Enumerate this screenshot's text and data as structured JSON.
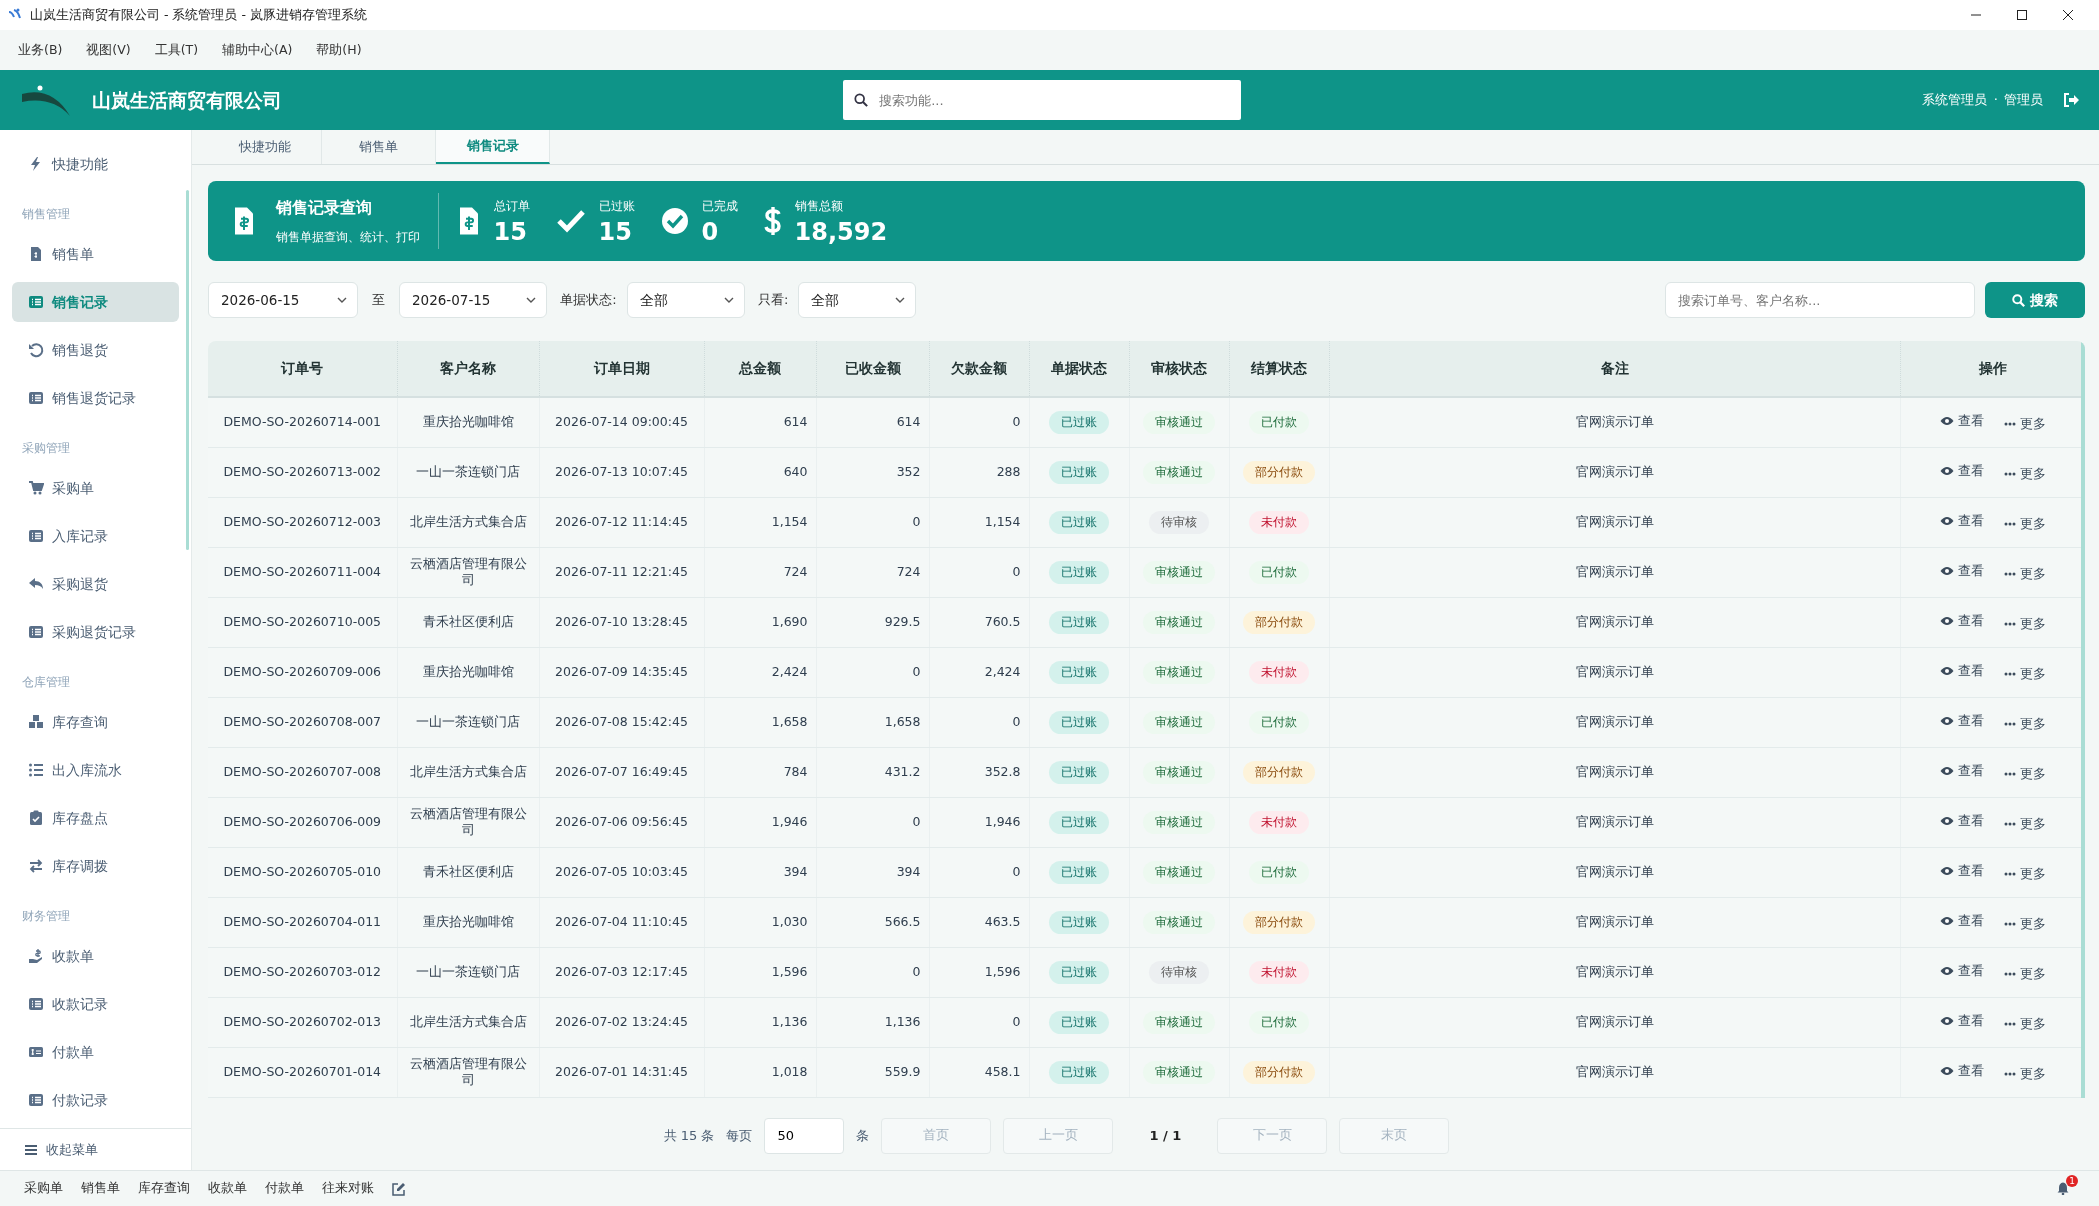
{
  "window": {
    "title": "山岚生活商贸有限公司 - 系统管理员 - 岚豚进销存管理系统"
  },
  "menu": [
    "业务(B)",
    "视图(V)",
    "工具(T)",
    "辅助中心(A)",
    "帮助(H)"
  ],
  "header": {
    "company": "山岚生活商贸有限公司",
    "search": {
      "placeholder": "搜索功能..."
    },
    "user": "系统管理员",
    "separator": "·",
    "role": "管理员"
  },
  "sidebar": {
    "items": [
      {
        "kind": "item",
        "label": "快捷功能",
        "selected": false
      },
      {
        "kind": "group",
        "label": "销售管理"
      },
      {
        "kind": "item",
        "label": "销售单",
        "selected": false
      },
      {
        "kind": "item",
        "label": "销售记录",
        "selected": true
      },
      {
        "kind": "item",
        "label": "销售退货",
        "selected": false
      },
      {
        "kind": "item",
        "label": "销售退货记录",
        "selected": false
      },
      {
        "kind": "group",
        "label": "采购管理"
      },
      {
        "kind": "item",
        "label": "采购单",
        "selected": false
      },
      {
        "kind": "item",
        "label": "入库记录",
        "selected": false
      },
      {
        "kind": "item",
        "label": "采购退货",
        "selected": false
      },
      {
        "kind": "item",
        "label": "采购退货记录",
        "selected": false
      },
      {
        "kind": "group",
        "label": "仓库管理"
      },
      {
        "kind": "item",
        "label": "库存查询",
        "selected": false
      },
      {
        "kind": "item",
        "label": "出入库流水",
        "selected": false
      },
      {
        "kind": "item",
        "label": "库存盘点",
        "selected": false
      },
      {
        "kind": "item",
        "label": "库存调拨",
        "selected": false
      },
      {
        "kind": "group",
        "label": "财务管理"
      },
      {
        "kind": "item",
        "label": "收款单",
        "selected": false
      },
      {
        "kind": "item",
        "label": "收款记录",
        "selected": false
      },
      {
        "kind": "item",
        "label": "付款单",
        "selected": false
      },
      {
        "kind": "item",
        "label": "付款记录",
        "selected": false
      }
    ],
    "collapse": "收起菜单"
  },
  "tabs": [
    {
      "label": "快捷功能",
      "selected": false
    },
    {
      "label": "销售单",
      "selected": false
    },
    {
      "label": "销售记录",
      "selected": true
    }
  ],
  "summary": {
    "title": "销售记录查询",
    "subtitle": "销售单据查询、统计、打印",
    "stats": [
      {
        "label": "总订单",
        "value": "15"
      },
      {
        "label": "已过账",
        "value": "15"
      },
      {
        "label": "已完成",
        "value": "0"
      },
      {
        "label": "销售总额",
        "value": "18,592"
      }
    ]
  },
  "filters": {
    "date_from": "2026-06-15",
    "to": "至",
    "date_to": "2026-07-15",
    "status_label": "单据状态:",
    "status": "全部",
    "only_label": "只看:",
    "only": "全部",
    "search": {
      "placeholder": "搜索订单号、客户名称..."
    },
    "search_button": "搜索"
  },
  "table": {
    "columns": [
      "订单号",
      "客户名称",
      "订单日期",
      "总金额",
      "已收金额",
      "欠款金额",
      "单据状态",
      "审核状态",
      "结算状态",
      "备注",
      "操作"
    ],
    "rows": [
      {
        "order": "DEMO-SO-20260714-001",
        "customer": "重庆拾光咖啡馆",
        "date": "2026-07-14 09:00:45",
        "total": "614",
        "received": "614",
        "owed": "0",
        "doc": {
          "text": "已过账",
          "kind": "posted"
        },
        "audit": {
          "text": "审核通过",
          "kind": "approved"
        },
        "settle": {
          "text": "已付款",
          "kind": "paid"
        },
        "note": "官网演示订单",
        "view": "查看",
        "more": "更多"
      },
      {
        "order": "DEMO-SO-20260713-002",
        "customer": "一山一茶连锁门店",
        "date": "2026-07-13 10:07:45",
        "total": "640",
        "received": "352",
        "owed": "288",
        "doc": {
          "text": "已过账",
          "kind": "posted"
        },
        "audit": {
          "text": "审核通过",
          "kind": "approved"
        },
        "settle": {
          "text": "部分付款",
          "kind": "partial"
        },
        "note": "官网演示订单",
        "view": "查看",
        "more": "更多"
      },
      {
        "order": "DEMO-SO-20260712-003",
        "customer": "北岸生活方式集合店",
        "date": "2026-07-12 11:14:45",
        "total": "1,154",
        "received": "0",
        "owed": "1,154",
        "doc": {
          "text": "已过账",
          "kind": "posted"
        },
        "audit": {
          "text": "待审核",
          "kind": "pending"
        },
        "settle": {
          "text": "未付款",
          "kind": "unpaid"
        },
        "note": "官网演示订单",
        "view": "查看",
        "more": "更多"
      },
      {
        "order": "DEMO-SO-20260711-004",
        "customer": "云栖酒店管理有限公司",
        "date": "2026-07-11 12:21:45",
        "total": "724",
        "received": "724",
        "owed": "0",
        "doc": {
          "text": "已过账",
          "kind": "posted"
        },
        "audit": {
          "text": "审核通过",
          "kind": "approved"
        },
        "settle": {
          "text": "已付款",
          "kind": "paid"
        },
        "note": "官网演示订单",
        "view": "查看",
        "more": "更多"
      },
      {
        "order": "DEMO-SO-20260710-005",
        "customer": "青禾社区便利店",
        "date": "2026-07-10 13:28:45",
        "total": "1,690",
        "received": "929.5",
        "owed": "760.5",
        "doc": {
          "text": "已过账",
          "kind": "posted"
        },
        "audit": {
          "text": "审核通过",
          "kind": "approved"
        },
        "settle": {
          "text": "部分付款",
          "kind": "partial"
        },
        "note": "官网演示订单",
        "view": "查看",
        "more": "更多"
      },
      {
        "order": "DEMO-SO-20260709-006",
        "customer": "重庆拾光咖啡馆",
        "date": "2026-07-09 14:35:45",
        "total": "2,424",
        "received": "0",
        "owed": "2,424",
        "doc": {
          "text": "已过账",
          "kind": "posted"
        },
        "audit": {
          "text": "审核通过",
          "kind": "approved"
        },
        "settle": {
          "text": "未付款",
          "kind": "unpaid"
        },
        "note": "官网演示订单",
        "view": "查看",
        "more": "更多"
      },
      {
        "order": "DEMO-SO-20260708-007",
        "customer": "一山一茶连锁门店",
        "date": "2026-07-08 15:42:45",
        "total": "1,658",
        "received": "1,658",
        "owed": "0",
        "doc": {
          "text": "已过账",
          "kind": "posted"
        },
        "audit": {
          "text": "审核通过",
          "kind": "approved"
        },
        "settle": {
          "text": "已付款",
          "kind": "paid"
        },
        "note": "官网演示订单",
        "view": "查看",
        "more": "更多"
      },
      {
        "order": "DEMO-SO-20260707-008",
        "customer": "北岸生活方式集合店",
        "date": "2026-07-07 16:49:45",
        "total": "784",
        "received": "431.2",
        "owed": "352.8",
        "doc": {
          "text": "已过账",
          "kind": "posted"
        },
        "audit": {
          "text": "审核通过",
          "kind": "approved"
        },
        "settle": {
          "text": "部分付款",
          "kind": "partial"
        },
        "note": "官网演示订单",
        "view": "查看",
        "more": "更多"
      },
      {
        "order": "DEMO-SO-20260706-009",
        "customer": "云栖酒店管理有限公司",
        "date": "2026-07-06 09:56:45",
        "total": "1,946",
        "received": "0",
        "owed": "1,946",
        "doc": {
          "text": "已过账",
          "kind": "posted"
        },
        "audit": {
          "text": "审核通过",
          "kind": "approved"
        },
        "settle": {
          "text": "未付款",
          "kind": "unpaid"
        },
        "note": "官网演示订单",
        "view": "查看",
        "more": "更多"
      },
      {
        "order": "DEMO-SO-20260705-010",
        "customer": "青禾社区便利店",
        "date": "2026-07-05 10:03:45",
        "total": "394",
        "received": "394",
        "owed": "0",
        "doc": {
          "text": "已过账",
          "kind": "posted"
        },
        "audit": {
          "text": "审核通过",
          "kind": "approved"
        },
        "settle": {
          "text": "已付款",
          "kind": "paid"
        },
        "note": "官网演示订单",
        "view": "查看",
        "more": "更多"
      },
      {
        "order": "DEMO-SO-20260704-011",
        "customer": "重庆拾光咖啡馆",
        "date": "2026-07-04 11:10:45",
        "total": "1,030",
        "received": "566.5",
        "owed": "463.5",
        "doc": {
          "text": "已过账",
          "kind": "posted"
        },
        "audit": {
          "text": "审核通过",
          "kind": "approved"
        },
        "settle": {
          "text": "部分付款",
          "kind": "partial"
        },
        "note": "官网演示订单",
        "view": "查看",
        "more": "更多"
      },
      {
        "order": "DEMO-SO-20260703-012",
        "customer": "一山一茶连锁门店",
        "date": "2026-07-03 12:17:45",
        "total": "1,596",
        "received": "0",
        "owed": "1,596",
        "doc": {
          "text": "已过账",
          "kind": "posted"
        },
        "audit": {
          "text": "待审核",
          "kind": "pending"
        },
        "settle": {
          "text": "未付款",
          "kind": "unpaid"
        },
        "note": "官网演示订单",
        "view": "查看",
        "more": "更多"
      },
      {
        "order": "DEMO-SO-20260702-013",
        "customer": "北岸生活方式集合店",
        "date": "2026-07-02 13:24:45",
        "total": "1,136",
        "received": "1,136",
        "owed": "0",
        "doc": {
          "text": "已过账",
          "kind": "posted"
        },
        "audit": {
          "text": "审核通过",
          "kind": "approved"
        },
        "settle": {
          "text": "已付款",
          "kind": "paid"
        },
        "note": "官网演示订单",
        "view": "查看",
        "more": "更多"
      },
      {
        "order": "DEMO-SO-20260701-014",
        "customer": "云栖酒店管理有限公司",
        "date": "2026-07-01 14:31:45",
        "total": "1,018",
        "received": "559.9",
        "owed": "458.1",
        "doc": {
          "text": "已过账",
          "kind": "posted"
        },
        "audit": {
          "text": "审核通过",
          "kind": "approved"
        },
        "settle": {
          "text": "部分付款",
          "kind": "partial"
        },
        "note": "官网演示订单",
        "view": "查看",
        "more": "更多"
      }
    ]
  },
  "pagination": {
    "total": "共 15 条",
    "per_page_label": "每页",
    "per_page": "50",
    "unit": "条",
    "first": {
      "label": "首页",
      "disabled": true
    },
    "prev": {
      "label": "上一页",
      "disabled": true
    },
    "page": "1 / 1",
    "next": {
      "label": "下一页",
      "disabled": true
    },
    "last": {
      "label": "末页",
      "disabled": true
    }
  },
  "taskbar": {
    "shortcuts": [
      "采购单",
      "销售单",
      "库存查询",
      "收款单",
      "付款单",
      "往来对账"
    ],
    "notifications": "1"
  }
}
